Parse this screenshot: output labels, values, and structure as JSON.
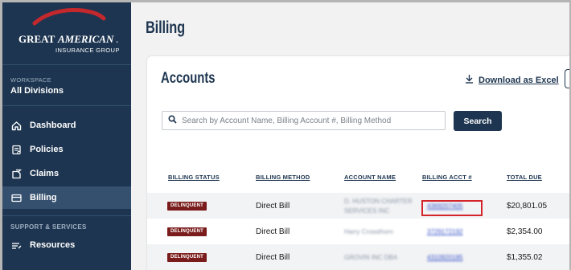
{
  "brand": {
    "logo_text_great": "GREAT",
    "logo_text_american": "AMERICAN",
    "logo_text_sub": "INSURANCE GROUP",
    "logo_mark": ".",
    "colors": {
      "sidebar": "#1d3550",
      "accent_red": "#b3262b",
      "navy": "#1d3550"
    }
  },
  "sidebar": {
    "workspace_label": "WORKSPACE",
    "workspace_value": "All Divisions",
    "items": [
      {
        "label": "Dashboard",
        "icon": "home-icon",
        "active": false
      },
      {
        "label": "Policies",
        "icon": "policy-document-icon",
        "active": false
      },
      {
        "label": "Claims",
        "icon": "claims-icon",
        "active": false
      },
      {
        "label": "Billing",
        "icon": "billing-card-icon",
        "active": true
      }
    ],
    "section_label": "SUPPORT & SERVICES",
    "section_items": [
      {
        "label": "Resources",
        "icon": "resources-icon"
      }
    ]
  },
  "main": {
    "page_title": "Billing",
    "card": {
      "title": "Accounts",
      "download_label": "Download as Excel",
      "search_placeholder": "Search by Account Name, Billing Account #, Billing Method",
      "search_value": "",
      "search_button": "Search",
      "columns": [
        "BILLING STATUS",
        "BILLING METHOD",
        "ACCOUNT NAME",
        "BILLING ACCT #",
        "TOTAL DUE"
      ],
      "rows": [
        {
          "status": "DELINQUENT",
          "method": "Direct Bill",
          "account_name_line1": "D. HUSTON CHARTER",
          "account_name_line2": "SERVICES INC",
          "acct_no": "4369207405",
          "total_due": "$20,801.05",
          "highlighted": true
        },
        {
          "status": "DELINQUENT",
          "method": "Direct Bill",
          "account_name_line1": "Harry Crossthorn",
          "account_name_line2": "",
          "acct_no": "3729172192",
          "total_due": "$2,354.00",
          "highlighted": false
        },
        {
          "status": "DELINQUENT",
          "method": "Direct Bill",
          "account_name_line1": "GROVIN INC DBA",
          "account_name_line2": "",
          "acct_no": "4310920185",
          "total_due": "$1,355.02",
          "highlighted": false
        }
      ]
    }
  }
}
